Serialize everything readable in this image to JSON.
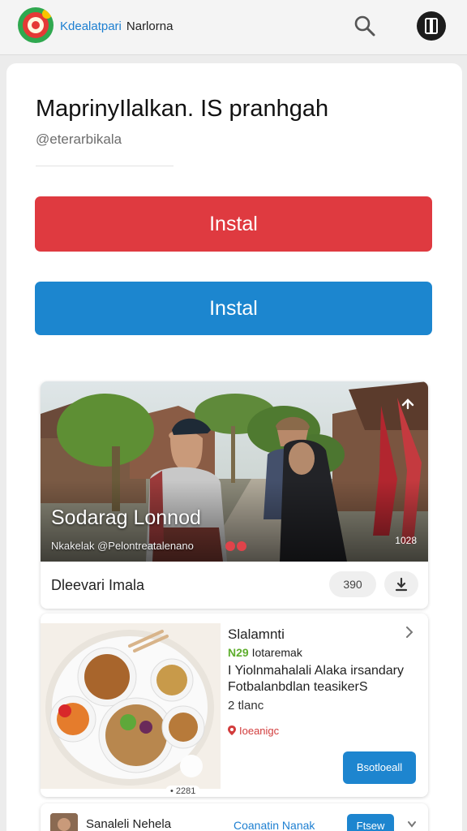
{
  "header": {
    "brand_primary": "Kdealatpari",
    "brand_secondary": "Narlorna",
    "search_icon": "search-icon",
    "menu_icon": "app-menu-icon"
  },
  "page": {
    "title": "MaprinyIlalkan. IS pranhgah",
    "subtitle": "@eterarbikala"
  },
  "buttons": {
    "install_red": "Instal",
    "install_blue": "Instal"
  },
  "video": {
    "title": "Sodarag Lonnod",
    "meta": "Nkakelak @Pelontreatalenano",
    "duration": "1028",
    "footer_label": "Dleevari Imala",
    "views": "390",
    "share_icon": "share-icon",
    "download_icon": "download-icon"
  },
  "food": {
    "title": "Slalamnti",
    "price_highlight": "N29",
    "price_rest": "Iotaremak",
    "desc_line1": "I Yiolnmahalali Alaka irsandary",
    "desc_line2": "Fotbalanbdlan teasikerS",
    "count": "2 tlanc",
    "location": "Ioeanigc",
    "image_badge": "• 2281",
    "action_label": "Bsotloeall"
  },
  "bottom_item": {
    "title": "Sanaleli Nehela",
    "link": "Coanatin Nanak",
    "button": "Ftsew"
  },
  "colors": {
    "install_red": "#df3a40",
    "install_blue": "#1c86cf",
    "accent_blue": "#1d7fd1",
    "price_green": "#5fae2e",
    "location_red": "#d23c3c"
  }
}
